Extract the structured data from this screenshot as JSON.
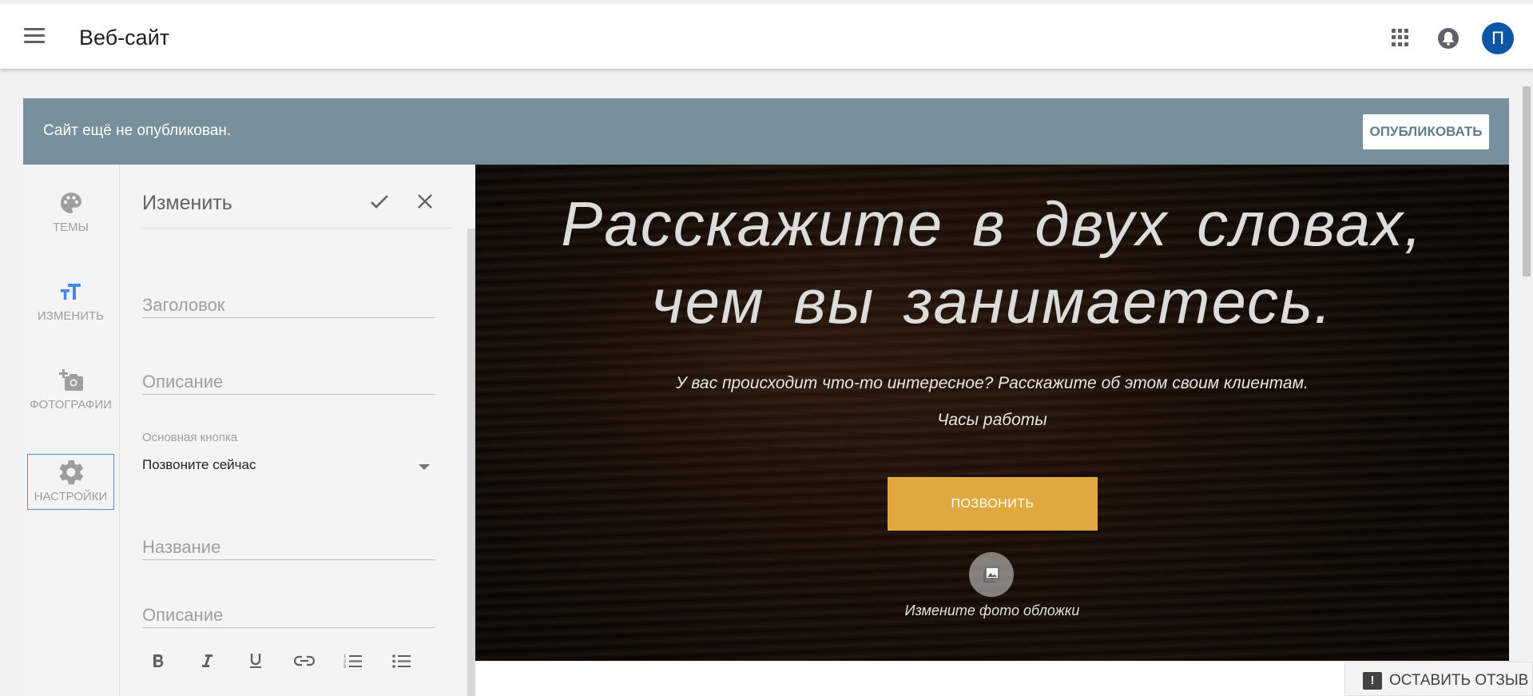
{
  "header": {
    "title": "Веб-сайт",
    "avatar_letter": "П"
  },
  "banner": {
    "text": "Сайт ещё не опубликован.",
    "publish_label": "ОПУБЛИКОВАТЬ"
  },
  "rail": {
    "items": [
      {
        "label": "ТЕМЫ",
        "icon": "palette-icon"
      },
      {
        "label": "ИЗМЕНИТЬ",
        "icon": "text-size-icon"
      },
      {
        "label": "ФОТОГРАФИИ",
        "icon": "add-photo-icon"
      },
      {
        "label": "НАСТРОЙКИ",
        "icon": "gear-icon"
      }
    ]
  },
  "panel": {
    "title": "Изменить",
    "fields": {
      "headline_placeholder": "Заголовок",
      "description_placeholder": "Описание",
      "button_caption": "Основная кнопка",
      "button_value": "Позвоните сейчас",
      "name_placeholder": "Название",
      "description2_placeholder": "Описание"
    }
  },
  "hero": {
    "title": "Расскажите в двух словах, чем вы занимаетесь.",
    "subtitle": "У вас происходит что-то интересное? Расскажите об этом своим клиентам.",
    "hours": "Часы работы",
    "call_button": "ПОЗВОНИТЬ",
    "change_photo": "Измените фото обложки"
  },
  "feedback": {
    "label": "ОСТАВИТЬ ОТЗЫВ"
  },
  "colors": {
    "banner": "#78909c",
    "accent": "#dfa93f",
    "avatar": "#0b57a6",
    "active_icon": "#4285f4"
  }
}
